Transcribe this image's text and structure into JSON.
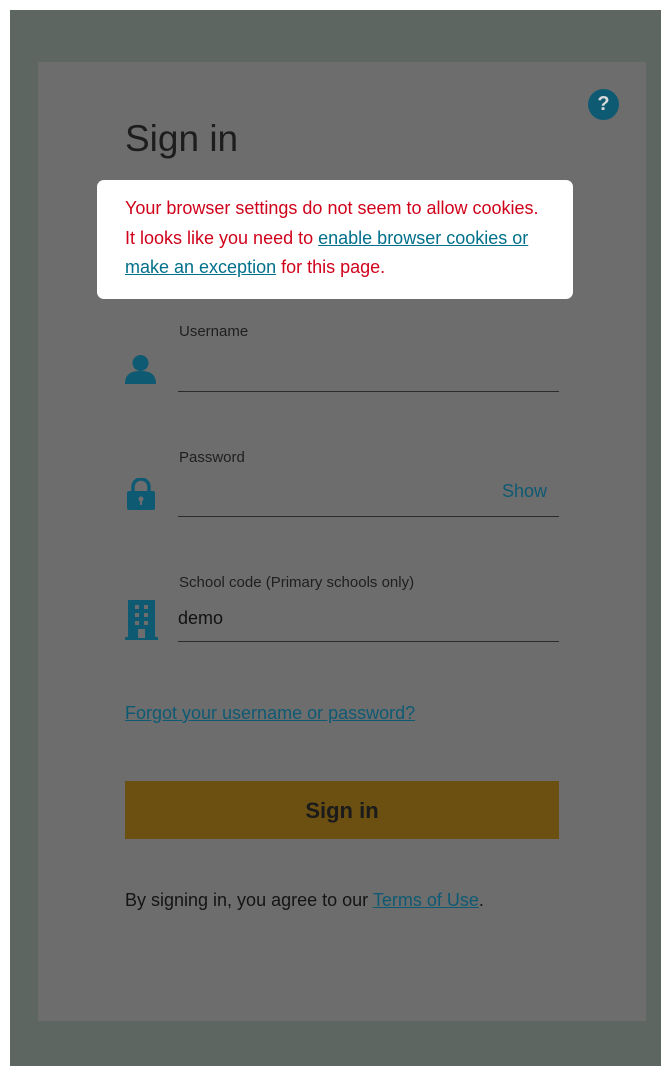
{
  "page": {
    "title": "Sign in",
    "help_label": "?"
  },
  "alert": {
    "text_before": "Your browser settings do not seem to allow cookies. It looks like you need to ",
    "link": "enable browser cookies or make an exception",
    "text_after": " for this page."
  },
  "form": {
    "username": {
      "label": "Username",
      "value": "",
      "icon": "user-icon"
    },
    "password": {
      "label": "Password",
      "value": "",
      "icon": "lock-icon",
      "show_label": "Show"
    },
    "school_code": {
      "label": "School code (Primary schools only)",
      "value": "demo",
      "icon": "building-icon"
    },
    "forgot_link": "Forgot your username or password?",
    "submit_label": "Sign in"
  },
  "footer": {
    "terms_prefix": "By signing in, you agree to our ",
    "terms_link": "Terms of Use",
    "terms_suffix": "."
  },
  "colors": {
    "overlay": "#5d6660",
    "card": "#6d6d6d",
    "accent": "#0e5a73",
    "alert_text": "#d0021b",
    "link_in_alert": "#00708b",
    "button": "#6b5012"
  }
}
